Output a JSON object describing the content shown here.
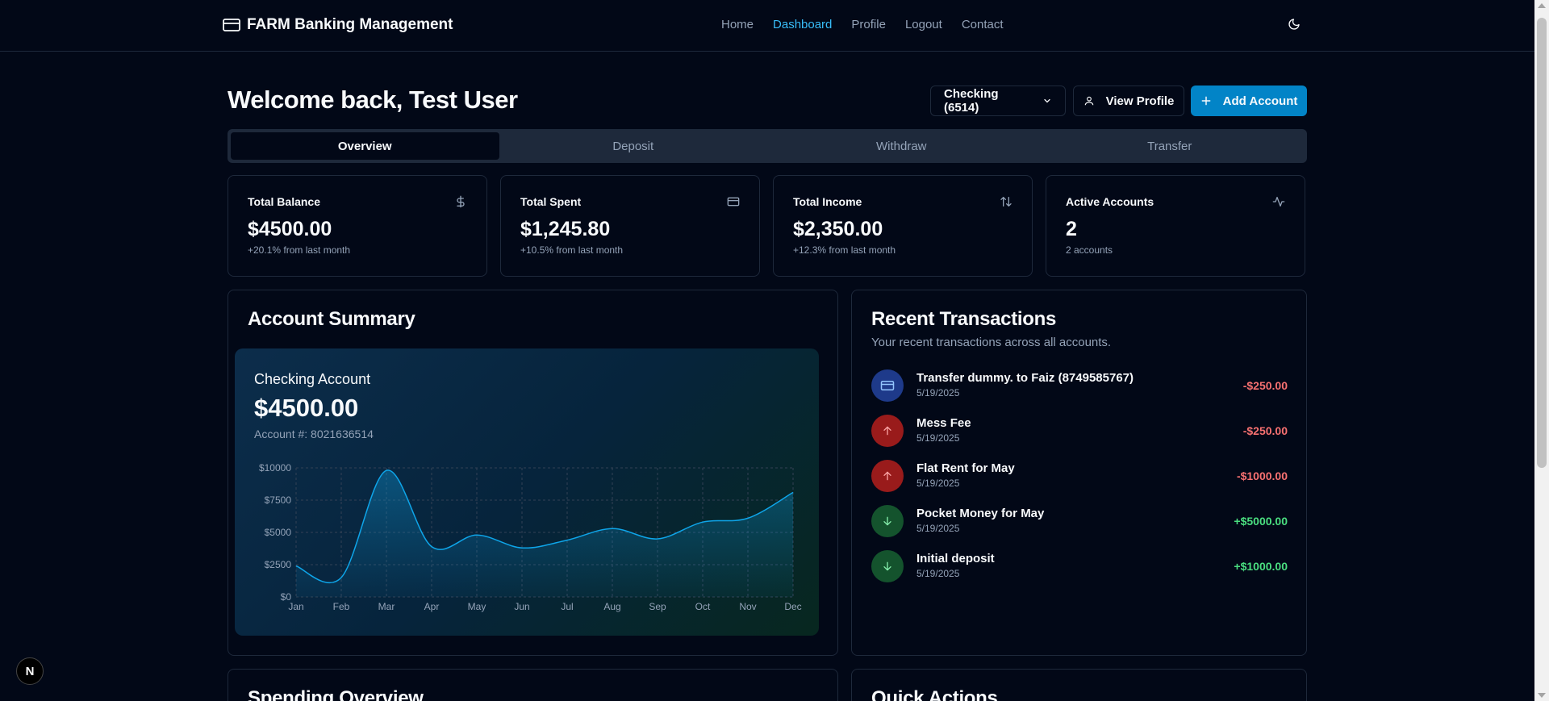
{
  "header": {
    "brand": "FARM Banking Management",
    "nav": [
      {
        "label": "Home",
        "active": false
      },
      {
        "label": "Dashboard",
        "active": true
      },
      {
        "label": "Profile",
        "active": false
      },
      {
        "label": "Logout",
        "active": false
      },
      {
        "label": "Contact",
        "active": false
      }
    ],
    "theme_icon": "moon-icon"
  },
  "welcome": "Welcome back, Test User",
  "account_select": {
    "value": "Checking (6514)"
  },
  "view_profile_label": "View Profile",
  "add_account_label": "Add Account",
  "tabs": [
    {
      "label": "Overview",
      "active": true
    },
    {
      "label": "Deposit",
      "active": false
    },
    {
      "label": "Withdraw",
      "active": false
    },
    {
      "label": "Transfer",
      "active": false
    }
  ],
  "stats": [
    {
      "title": "Total Balance",
      "value": "$4500.00",
      "sub": "+20.1% from last month",
      "icon": "dollar-icon"
    },
    {
      "title": "Total Spent",
      "value": "$1,245.80",
      "sub": "+10.5% from last month",
      "icon": "credit-card-icon"
    },
    {
      "title": "Total Income",
      "value": "$2,350.00",
      "sub": "+12.3% from last month",
      "icon": "arrows-up-down-icon"
    },
    {
      "title": "Active Accounts",
      "value": "2",
      "sub": "2 accounts",
      "icon": "activity-icon"
    }
  ],
  "account_summary": {
    "title": "Account Summary",
    "card_name": "Checking Account",
    "balance": "$4500.00",
    "account_number": "Account #: 8021636514"
  },
  "chart_data": {
    "type": "area",
    "x": [
      "Jan",
      "Feb",
      "Mar",
      "Apr",
      "May",
      "Jun",
      "Jul",
      "Aug",
      "Sep",
      "Oct",
      "Nov",
      "Dec"
    ],
    "values": [
      2400,
      1500,
      9800,
      3900,
      4800,
      3800,
      4400,
      5300,
      4500,
      5800,
      6100,
      8100
    ],
    "yticks": [
      "$0",
      "$2500",
      "$5000",
      "$7500",
      "$10000"
    ],
    "ylim": [
      0,
      10000
    ],
    "grid": true,
    "colors": {
      "line": "#0ea5e9",
      "grid": "#334155",
      "tick": "#94a3b8"
    }
  },
  "transactions": {
    "title": "Recent Transactions",
    "subtitle": "Your recent transactions across all accounts.",
    "items": [
      {
        "name": "Transfer dummy. to Faiz (8749585767)",
        "date": "5/19/2025",
        "amount": "-$250.00",
        "kind": "transfer",
        "icon": "credit-card-icon"
      },
      {
        "name": "Mess Fee",
        "date": "5/19/2025",
        "amount": "-$250.00",
        "kind": "withdraw",
        "icon": "arrow-up-icon"
      },
      {
        "name": "Flat Rent for May",
        "date": "5/19/2025",
        "amount": "-$1000.00",
        "kind": "withdraw",
        "icon": "arrow-up-icon"
      },
      {
        "name": "Pocket Money for May",
        "date": "5/19/2025",
        "amount": "+$5000.00",
        "kind": "deposit",
        "icon": "arrow-down-icon"
      },
      {
        "name": "Initial deposit",
        "date": "5/19/2025",
        "amount": "+$1000.00",
        "kind": "deposit",
        "icon": "arrow-down-icon"
      }
    ]
  },
  "spending_title": "Spending Overview",
  "quick_actions_title": "Quick Actions",
  "next_badge": "N",
  "colors": {
    "bg": "#020817",
    "accent": "#0284c7",
    "link": "#38bdf8",
    "negative": "#f87171",
    "positive": "#4ade80"
  }
}
